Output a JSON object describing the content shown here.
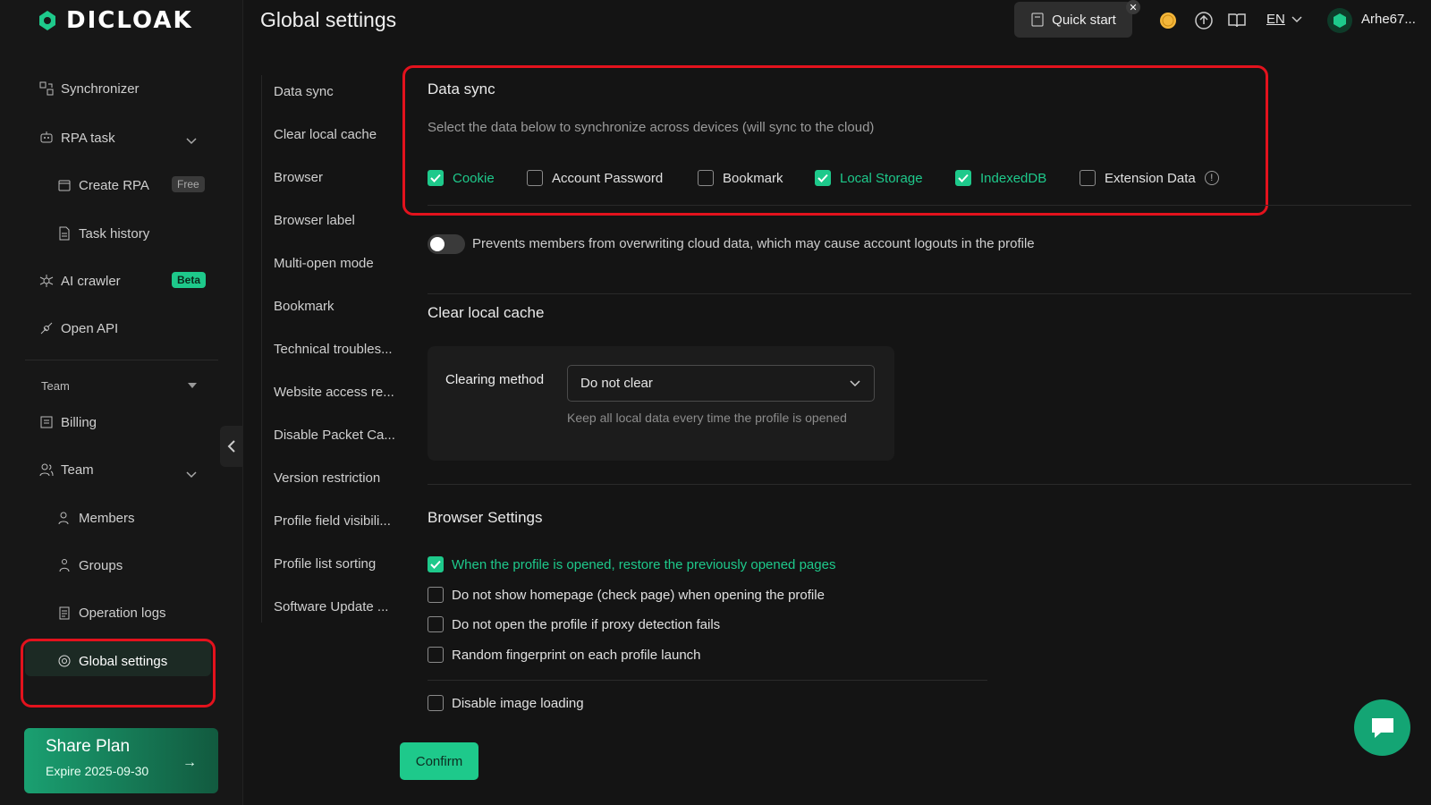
{
  "brand": {
    "name": "DICLOAK",
    "accent": "#1ec98b",
    "highlight": "#e3121d"
  },
  "sidebar": {
    "items": [
      {
        "label": "Synchronizer",
        "icon": "sync-icon"
      },
      {
        "label": "RPA task",
        "icon": "robot-icon"
      },
      {
        "label": "Create RPA",
        "icon": "create-icon",
        "badge": "Free"
      },
      {
        "label": "Task history",
        "icon": "document-icon"
      },
      {
        "label": "AI crawler",
        "icon": "spider-icon",
        "badge": "Beta"
      },
      {
        "label": "Open API",
        "icon": "api-icon"
      }
    ],
    "team_header": "Team",
    "team_items": [
      {
        "label": "Billing",
        "icon": "billing-icon"
      },
      {
        "label": "Team",
        "icon": "people-icon"
      },
      {
        "label": "Members",
        "icon": "member-icon"
      },
      {
        "label": "Groups",
        "icon": "groups-icon"
      },
      {
        "label": "Operation logs",
        "icon": "log-icon"
      },
      {
        "label": "Global settings",
        "icon": "settings-icon"
      }
    ],
    "share_plan": {
      "title": "Share Plan",
      "expire": "Expire 2025-09-30"
    }
  },
  "header": {
    "title": "Global settings",
    "quick_start": "Quick start",
    "language": "EN",
    "username": "Arhe67..."
  },
  "subnav": [
    "Data sync",
    "Clear local cache",
    "Browser",
    "Browser label",
    "Multi-open mode",
    "Bookmark",
    "Technical troubles...",
    "Website access re...",
    "Disable Packet Ca...",
    "Version restriction",
    "Profile field visibili...",
    "Profile list sorting",
    "Software Update ..."
  ],
  "data_sync": {
    "title": "Data sync",
    "description": "Select the data below to synchronize across devices (will sync to the cloud)",
    "options": [
      {
        "label": "Cookie",
        "checked": true
      },
      {
        "label": "Account Password",
        "checked": false
      },
      {
        "label": "Bookmark",
        "checked": false
      },
      {
        "label": "Local Storage",
        "checked": true
      },
      {
        "label": "IndexedDB",
        "checked": true
      },
      {
        "label": "Extension Data",
        "checked": false
      }
    ],
    "toggle_text": "Prevents members from overwriting cloud data, which may cause account logouts in the profile",
    "toggle_on": false
  },
  "clear_cache": {
    "title": "Clear local cache",
    "method_label": "Clearing method",
    "selected": "Do not clear",
    "hint": "Keep all local data every time the profile is opened"
  },
  "browser_settings": {
    "title": "Browser Settings",
    "options": [
      {
        "label": "When the profile is opened, restore the previously opened pages",
        "checked": true
      },
      {
        "label": "Do not show homepage (check page) when opening the profile",
        "checked": false
      },
      {
        "label": "Do not open the profile if proxy detection fails",
        "checked": false
      },
      {
        "label": "Random fingerprint on each profile launch",
        "checked": false
      },
      {
        "label": "Disable image loading",
        "checked": false
      }
    ]
  },
  "confirm_label": "Confirm"
}
